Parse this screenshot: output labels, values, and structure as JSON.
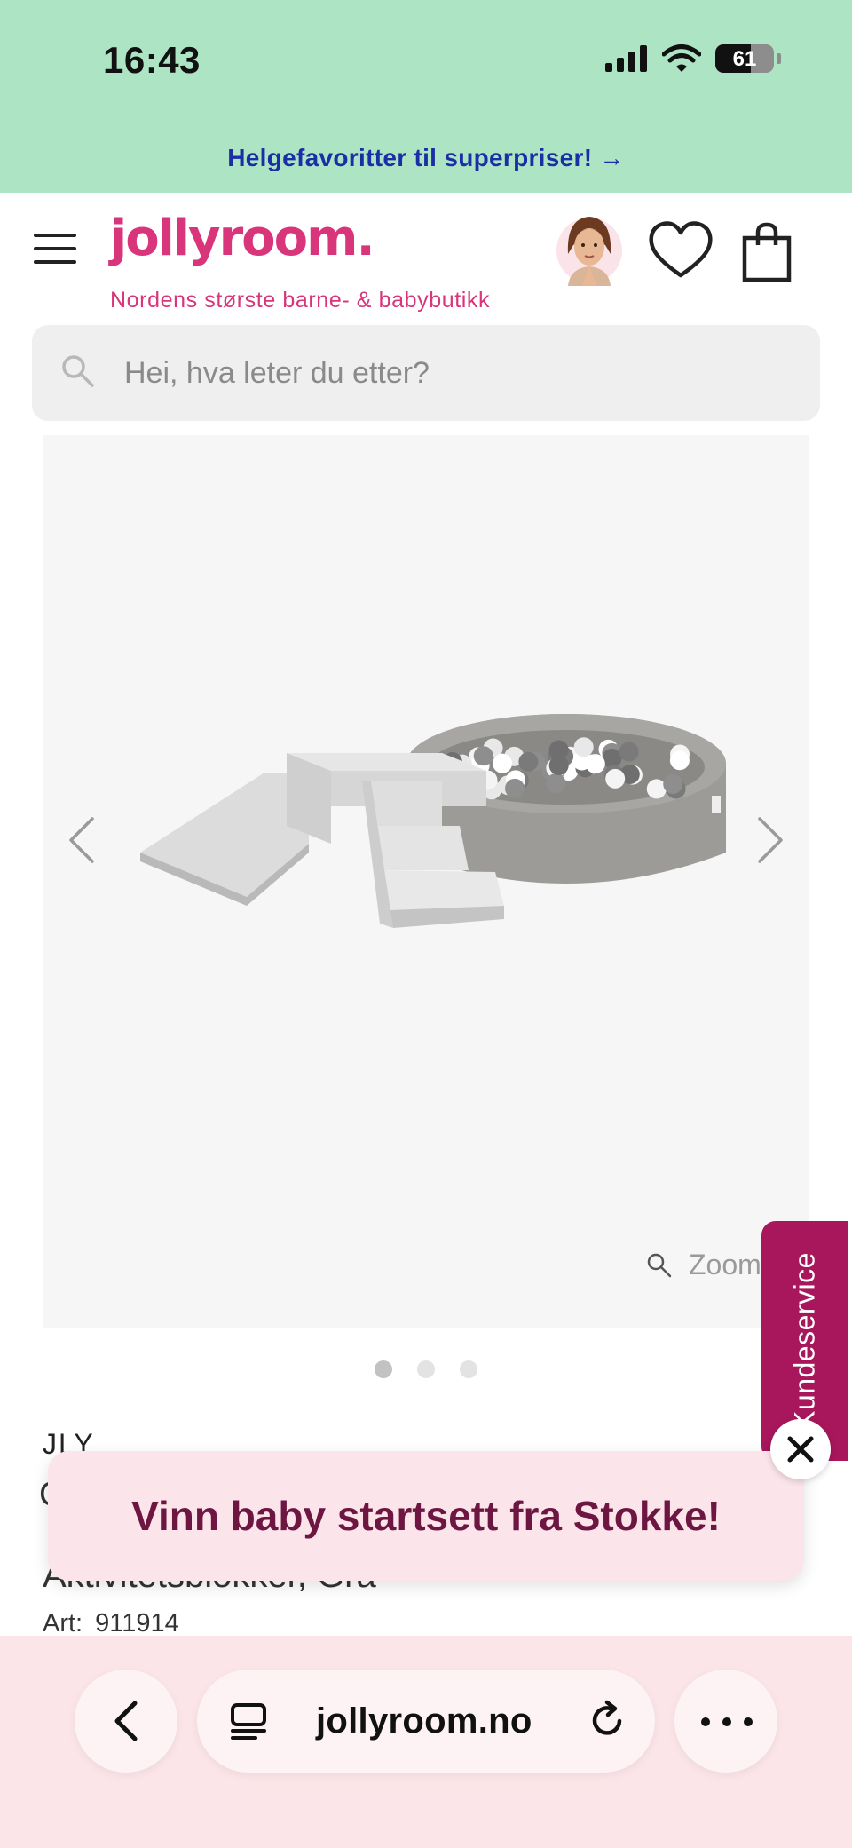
{
  "status_bar": {
    "time": "16:43",
    "battery": "61",
    "battery_level": 0.61
  },
  "promo_banner": {
    "text": "Helgefavoritter til superpriser! →"
  },
  "header": {
    "logo": "jollyroom.",
    "tagline": "Nordens største barne- & babybutikk"
  },
  "search": {
    "placeholder": "Hei, hva leter du etter?"
  },
  "gallery": {
    "zoom_label": "Zoom",
    "image_count": 3,
    "active_index": 0
  },
  "side_tab": {
    "label": "Kundeservice"
  },
  "product": {
    "brand": "JLY",
    "title_line1_fragment": "C",
    "title": "Aktivitetsblokker, Grå",
    "art_label": "Art:",
    "art_number": "911914"
  },
  "popup": {
    "text": "Vinn baby startsett fra Stokke!"
  },
  "browser": {
    "domain": "jollyroom.no"
  },
  "colors": {
    "banner_green": "#ade4c4",
    "brand_pink": "#d9357a",
    "promo_blue": "#1a2fa6",
    "tab_magenta": "#a8175c",
    "popup_bg": "#fbe4ea",
    "popup_text": "#6e1642",
    "browser_bg": "#fbe5e8"
  }
}
